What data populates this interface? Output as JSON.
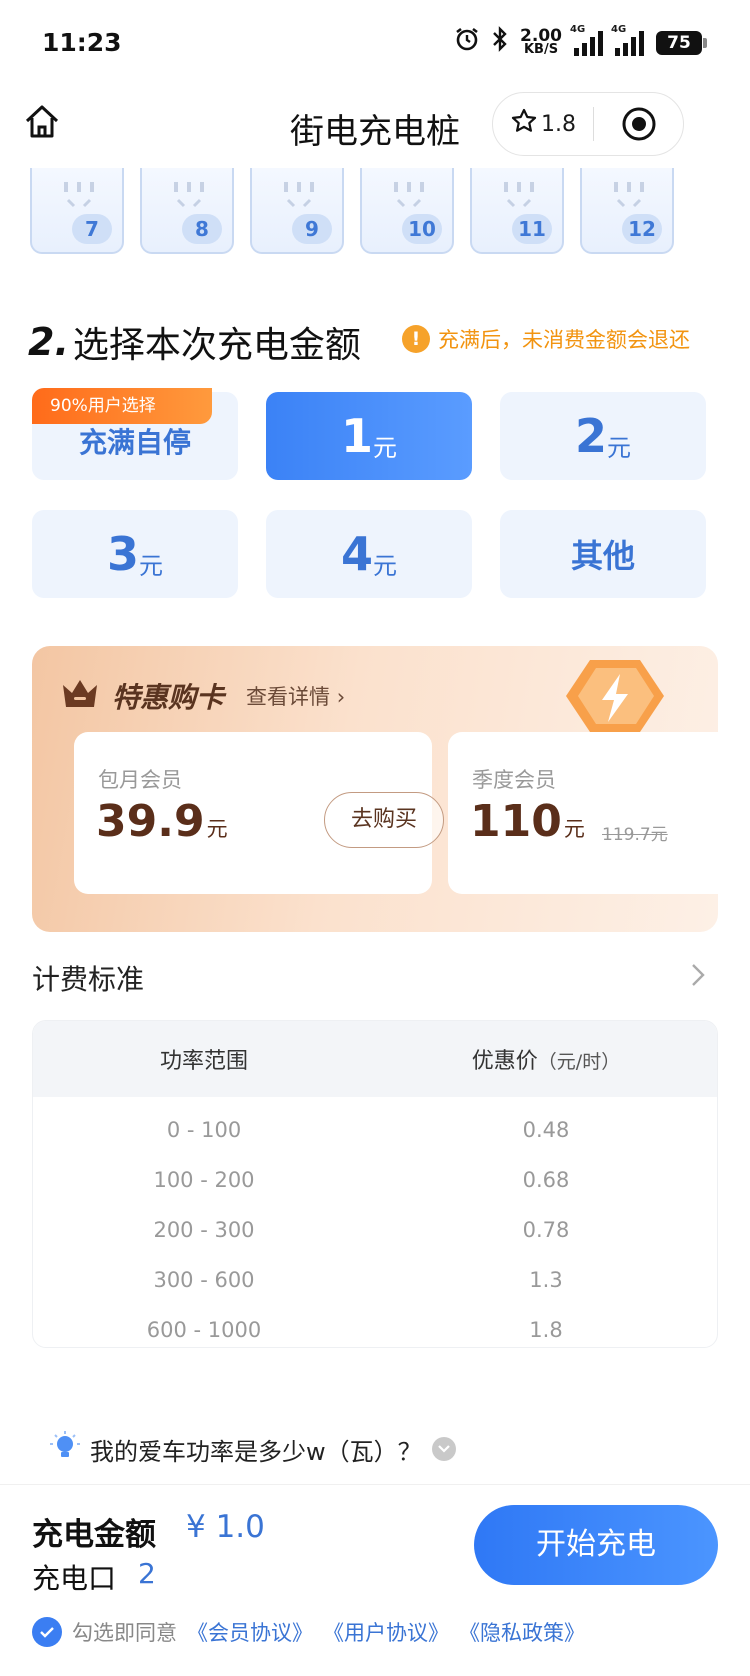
{
  "status": {
    "time": "11:23",
    "net_speed": "2.00",
    "net_unit": "KB/S",
    "sim1": "4G",
    "sim2": "4G",
    "battery": "75"
  },
  "header": {
    "title": "街电充电桩",
    "rating": "1.8",
    "icons": [
      "home-icon",
      "star-icon",
      "target-icon"
    ]
  },
  "sockets": [
    "7",
    "8",
    "9",
    "10",
    "11",
    "12"
  ],
  "section2": {
    "number": "2.",
    "title": "选择本次充电金额",
    "note": "充满后，未消费金额会退还"
  },
  "amounts": {
    "badge": "90%用户选择",
    "auto_stop": "充满自停",
    "options": [
      {
        "value": "1",
        "unit": "元",
        "selected": true
      },
      {
        "value": "2",
        "unit": "元",
        "selected": false
      },
      {
        "value": "3",
        "unit": "元",
        "selected": false
      },
      {
        "value": "4",
        "unit": "元",
        "selected": false
      }
    ],
    "other": "其他"
  },
  "promo": {
    "title": "特惠购卡",
    "detail_link": "查看详情",
    "monthly": {
      "label": "包月会员",
      "price": "39.9",
      "unit": "元"
    },
    "quarterly": {
      "label": "季度会员",
      "price": "110",
      "unit": "元",
      "original": "119.7元"
    },
    "buy": "去购买"
  },
  "billing": {
    "title": "计费标准",
    "col1": "功率范围",
    "col2": "优惠价",
    "col2_unit": "（元/时）",
    "rows": [
      {
        "range": "0 - 100",
        "price": "0.48"
      },
      {
        "range": "100 - 200",
        "price": "0.68"
      },
      {
        "range": "200 - 300",
        "price": "0.78"
      },
      {
        "range": "300 - 600",
        "price": "1.3"
      },
      {
        "range": "600 - 1000",
        "price": "1.8"
      }
    ]
  },
  "tip": "我的爱车功率是多少w（瓦）？",
  "bottom": {
    "amount_label": "充电金额",
    "amount_value": "¥ 1.0",
    "port_label": "充电口",
    "port_value": "2",
    "start": "开始充电",
    "agree_prefix": "勾选即同意",
    "links": [
      "《会员协议》",
      "《用户协议》",
      "《隐私政策》"
    ]
  },
  "colors": {
    "accent": "#3b82f6",
    "warning": "#f29411",
    "promo_brown": "#5a2e1a"
  }
}
